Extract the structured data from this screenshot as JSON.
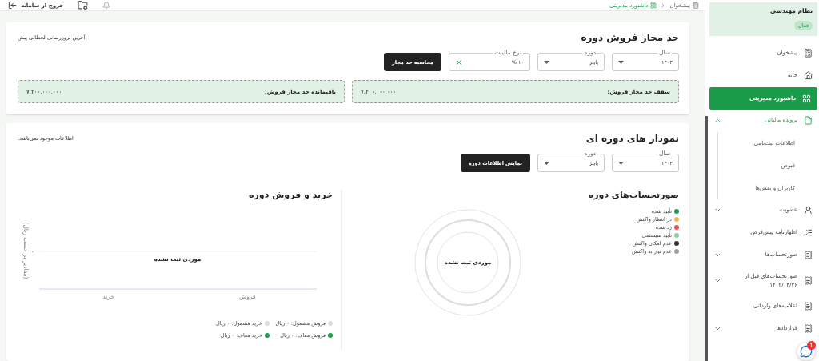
{
  "topbar": {
    "logout": "خروج از سامانه",
    "breadcrumb": [
      {
        "label": "پیشخوان",
        "selected": false
      },
      {
        "label": "داشبورد مدیریتی",
        "selected": true
      }
    ]
  },
  "sales_limit": {
    "title": "حد مجاز فروش دوره",
    "updated": "آخرین بروزرسانی لحظاتی پیش",
    "fields": [
      {
        "kind": "select",
        "label": "سال",
        "value": "۱۴۰۳"
      },
      {
        "kind": "select",
        "label": "دوره",
        "value": "پاییز"
      },
      {
        "kind": "clearable",
        "label": "نرخ مالیات",
        "value": "۱۰ %"
      }
    ],
    "button": "محاسبه حد مجاز",
    "totals": [
      {
        "label": "سقف حد مجاز فروش:",
        "value": "۷,۲۰۰,۰۰۰,۰۰۰"
      },
      {
        "label": "باقیمانده حد مجاز فروش:",
        "value": "۷,۲۰۰,۰۰۰,۰۰۰"
      }
    ]
  },
  "period_charts": {
    "title": "نمودار های دوره ای",
    "notice": "اطلاعات موجود نمی‌باشد.",
    "fields": [
      {
        "kind": "select",
        "label": "سال",
        "value": "۱۴۰۳"
      },
      {
        "kind": "select",
        "label": "دوره",
        "value": "پاییز"
      }
    ],
    "button": "نمایش اطلاعات دوره",
    "invoices": {
      "title": "صورتحساب‌های دوره",
      "empty": "موردی ثبت نشده",
      "legend": [
        {
          "label": "تأیید شده",
          "color": "#1a9c4a"
        },
        {
          "label": "در انتظار واکنش",
          "color": "#f5b942"
        },
        {
          "label": "رد شده",
          "color": "#ee4b4b"
        },
        {
          "label": "تأیید سیستمی",
          "color": "#8fd19e"
        },
        {
          "label": "عدم امکان واکنش",
          "color": "#333333"
        },
        {
          "label": "عدم نیاز به واکنش",
          "color": "#9e9e9e"
        }
      ]
    },
    "trade": {
      "title": "خرید و فروش دوره",
      "empty": "موردی ثبت نشده",
      "axis": {
        "y_label": "(مقادیر بر حسب ریال)",
        "y_tick": "۰",
        "x_labels": [
          "فروش",
          "خرید"
        ]
      },
      "legend": [
        {
          "label": "فروش مشمول: ۰ ریال",
          "color": "#dddddd"
        },
        {
          "label": "خرید مشمول: ۰ ریال",
          "color": "#dddddd"
        },
        {
          "label": "فروش معاف: ۰ ریال",
          "color": "#1a9c4a"
        },
        {
          "label": "خرید معاف: ۰ ریال",
          "color": "#1a9c4a"
        }
      ]
    }
  },
  "sidebar": {
    "org": {
      "name": "نظام مهندسی",
      "status": "فعال"
    },
    "items": [
      {
        "label": "پیشخوان",
        "selected": false
      },
      {
        "label": "خانه",
        "selected": false
      },
      {
        "label": "داشبورد مدیریتی",
        "selected": true
      },
      {
        "label": "پرونده مالیاتی",
        "selected": false,
        "expanded": true,
        "children": [
          {
            "label": "اطلاعات ثبت‌نامی"
          },
          {
            "label": "قبوض"
          },
          {
            "label": "کاربران و نقش‌ها"
          }
        ]
      },
      {
        "label": "عضویت",
        "selected": false,
        "expanded": false
      },
      {
        "label": "اظهارنامه پیش‌فرض",
        "selected": false
      },
      {
        "label": "صورتحساب‌ها",
        "selected": false,
        "expanded": false
      },
      {
        "label": "صورتحساب‌های قبل از ۱۴۰۲/۰۳/۲۶",
        "selected": false,
        "expanded": false
      },
      {
        "label": "اعلامیه‌های وارداتی",
        "selected": false
      },
      {
        "label": "قراردادها",
        "selected": false,
        "expanded": false
      }
    ]
  },
  "chat": {
    "badge": "1"
  }
}
